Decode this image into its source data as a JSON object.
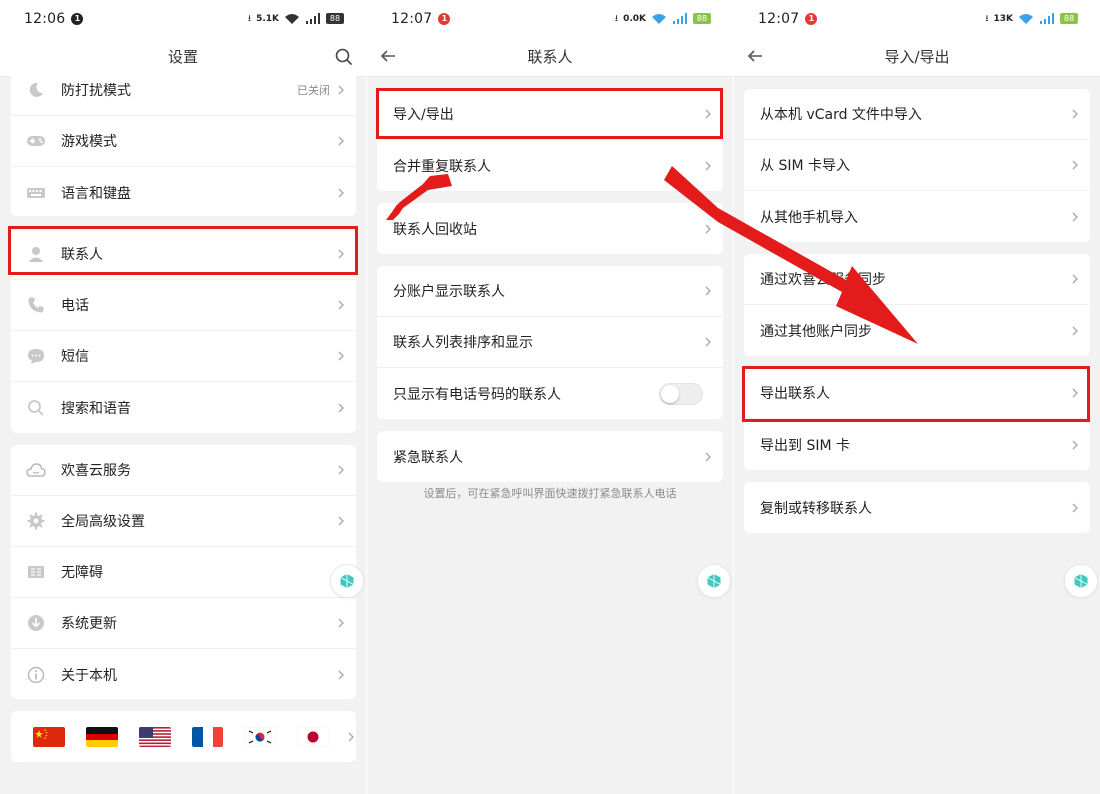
{
  "screens": [
    {
      "status": {
        "time": "12:06",
        "badge": "1",
        "speed": "5.1K",
        "battery": "88"
      },
      "title": "设置",
      "groups": [
        [
          {
            "label": "防打扰模式",
            "status": "已关闭",
            "icon": "moon-icon"
          },
          {
            "label": "游戏模式",
            "icon": "gamepad-icon"
          },
          {
            "label": "语言和键盘",
            "icon": "keyboard-icon"
          }
        ],
        [
          {
            "label": "联系人",
            "icon": "person-icon"
          },
          {
            "label": "电话",
            "icon": "phone-icon"
          },
          {
            "label": "短信",
            "icon": "message-icon"
          },
          {
            "label": "搜索和语音",
            "icon": "search-icon"
          }
        ],
        [
          {
            "label": "欢喜云服务",
            "icon": "cloud-icon"
          },
          {
            "label": "全局高级设置",
            "icon": "gear-icon"
          },
          {
            "label": "无障碍",
            "icon": "accessibility-icon"
          },
          {
            "label": "系统更新",
            "icon": "download-icon"
          },
          {
            "label": "关于本机",
            "icon": "info-icon"
          }
        ]
      ],
      "flags": [
        "china-flag-icon",
        "germany-flag-icon",
        "usa-flag-icon",
        "france-flag-icon",
        "korea-flag-icon",
        "japan-flag-icon"
      ]
    },
    {
      "status": {
        "time": "12:07",
        "badge": "1",
        "speed": "0.0K",
        "battery": "88"
      },
      "title": "联系人",
      "groups": [
        [
          {
            "label": "导入/导出"
          },
          {
            "label": "合并重复联系人"
          }
        ],
        [
          {
            "label": "联系人回收站"
          }
        ],
        [
          {
            "label": "分账户显示联系人"
          },
          {
            "label": "联系人列表排序和显示"
          },
          {
            "label": "只显示有电话号码的联系人",
            "toggle": false
          }
        ],
        [
          {
            "label": "紧急联系人"
          }
        ]
      ],
      "note": "设置后，可在紧急呼叫界面快速拨打紧急联系人电话"
    },
    {
      "status": {
        "time": "12:07",
        "badge": "1",
        "speed": "13K",
        "battery": "88"
      },
      "title": "导入/导出",
      "groups": [
        [
          {
            "label": "从本机 vCard 文件中导入"
          },
          {
            "label": "从 SIM 卡导入"
          },
          {
            "label": "从其他手机导入"
          }
        ],
        [
          {
            "label": "通过欢喜云服务同步"
          },
          {
            "label": "通过其他账户同步"
          }
        ],
        [
          {
            "label": "导出联系人"
          },
          {
            "label": "导出到 SIM 卡"
          }
        ],
        [
          {
            "label": "复制或转移联系人"
          }
        ]
      ]
    }
  ],
  "colors": {
    "highlight": "#e31b1b",
    "badge": "#e53935",
    "wifi": "#3aa0e8",
    "battery": "#8bc34a",
    "fab": "#3fc7c0"
  }
}
